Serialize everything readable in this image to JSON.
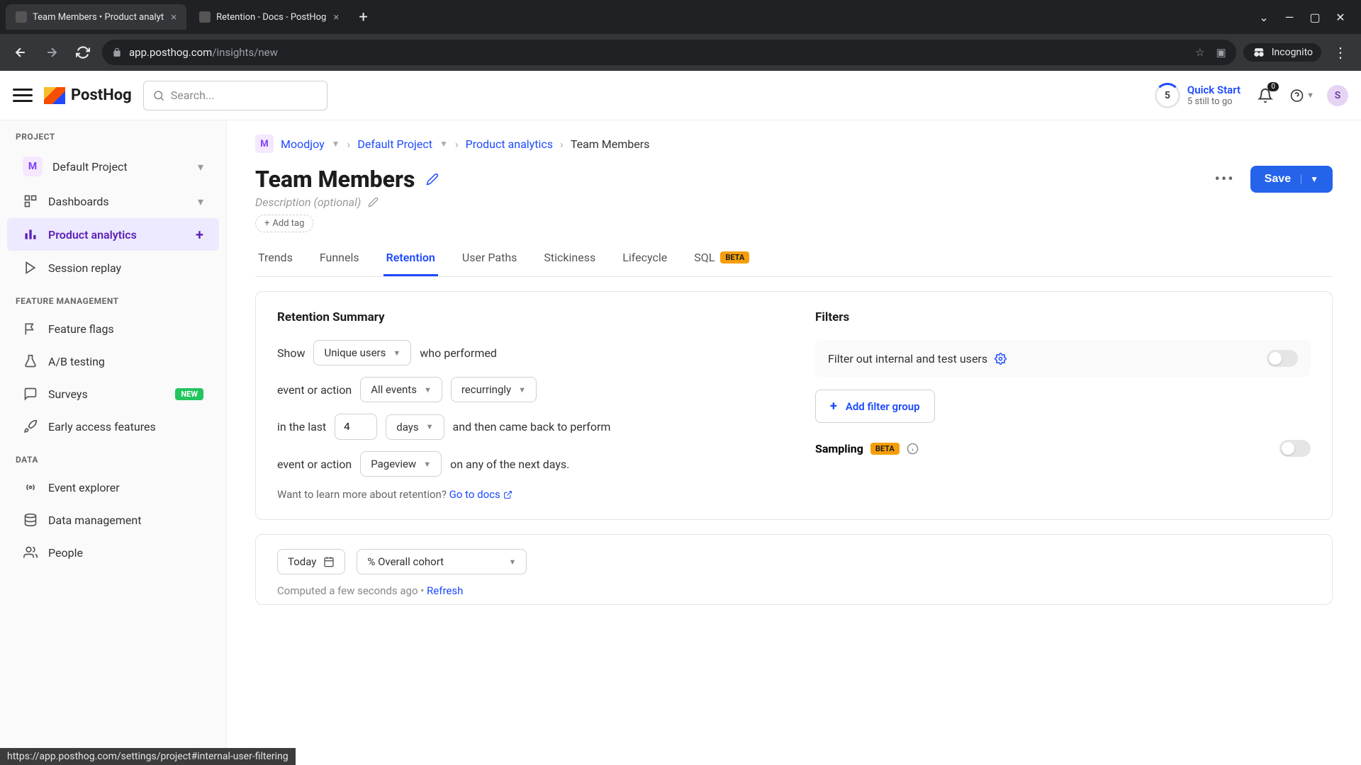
{
  "browser": {
    "tabs": [
      {
        "title": "Team Members • Product analyt",
        "active": true
      },
      {
        "title": "Retention - Docs - PostHog",
        "active": false
      }
    ],
    "url_host": "app.posthog.com",
    "url_path": "/insights/new",
    "incognito_label": "Incognito"
  },
  "topbar": {
    "logo_text": "PostHog",
    "search_placeholder": "Search...",
    "quick_start": {
      "count": "5",
      "title": "Quick Start",
      "subtitle": "5 still to go"
    },
    "notif_badge": "0",
    "avatar_letter": "S"
  },
  "sidebar": {
    "sections": {
      "project": "PROJECT",
      "feature": "FEATURE MANAGEMENT",
      "data": "DATA"
    },
    "project_badge": "M",
    "project_name": "Default Project",
    "items": {
      "dashboards": "Dashboards",
      "product_analytics": "Product analytics",
      "session_replay": "Session replay",
      "feature_flags": "Feature flags",
      "ab_testing": "A/B testing",
      "surveys": "Surveys",
      "surveys_badge": "NEW",
      "early_access": "Early access features",
      "event_explorer": "Event explorer",
      "data_management": "Data management",
      "people": "People"
    }
  },
  "breadcrumbs": {
    "org_badge": "M",
    "org": "Moodjoy",
    "project": "Default Project",
    "section": "Product analytics",
    "current": "Team Members"
  },
  "page": {
    "title": "Team Members",
    "description_placeholder": "Description (optional)",
    "add_tag_label": "Add tag",
    "save_label": "Save"
  },
  "tabs": {
    "trends": "Trends",
    "funnels": "Funnels",
    "retention": "Retention",
    "user_paths": "User Paths",
    "stickiness": "Stickiness",
    "lifecycle": "Lifecycle",
    "sql": "SQL",
    "sql_badge": "BETA"
  },
  "retention": {
    "title": "Retention Summary",
    "show_label": "Show",
    "show_value": "Unique users",
    "who_performed": "who performed",
    "event_or_action": "event or action",
    "all_events": "All events",
    "recurringly": "recurringly",
    "in_the_last": "in the last",
    "last_value": "4",
    "days": "days",
    "and_then": "and then came back to perform",
    "pageview": "Pageview",
    "on_any": "on any of the next days.",
    "learn_more_prefix": "Want to learn more about retention?",
    "learn_more_link": "Go to docs"
  },
  "filters": {
    "title": "Filters",
    "internal_users": "Filter out internal and test users",
    "add_filter_group": "Add filter group",
    "sampling": "Sampling",
    "sampling_badge": "BETA"
  },
  "results": {
    "today": "Today",
    "cohort": "% Overall cohort",
    "computed": "Computed a few seconds ago",
    "refresh": "Refresh"
  },
  "status_bar_url": "https://app.posthog.com/settings/project#internal-user-filtering"
}
